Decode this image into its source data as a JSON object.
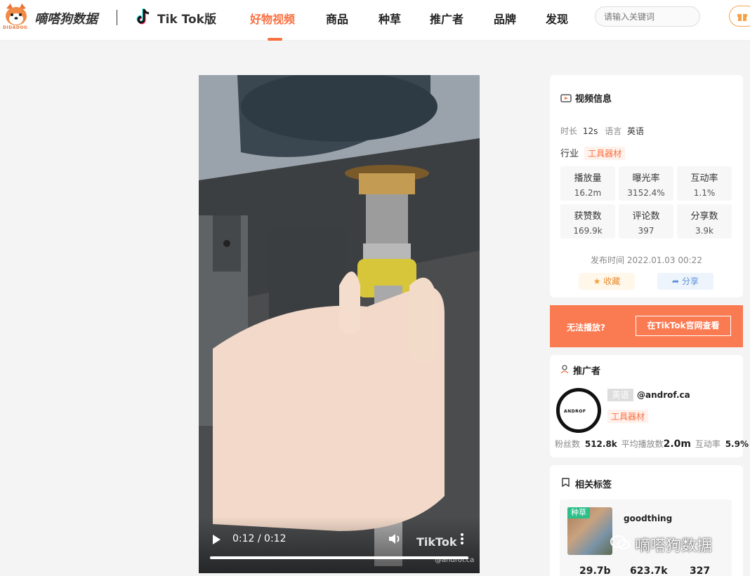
{
  "header": {
    "brand": "嘀嗒狗数据",
    "brand_badge": "DIDADOG",
    "platform": "Tik Tok版",
    "nav": [
      "好物视频",
      "商品",
      "种草",
      "推广者",
      "品牌",
      "发现"
    ],
    "search_placeholder": "请输入关键词"
  },
  "video": {
    "time": "0:12 / 0:12",
    "progress": 1.0,
    "watermark": "TikTok",
    "watermark_sub": "@androf.ca"
  },
  "video_info": {
    "title": "视频信息",
    "duration_label": "时长",
    "duration": "12s",
    "lang_label": "语言",
    "lang": "英语",
    "industry_label": "行业",
    "industry": "工具器材",
    "stats": [
      {
        "label": "播放量",
        "value": "16.2m"
      },
      {
        "label": "曝光率",
        "value": "3152.4%"
      },
      {
        "label": "互动率",
        "value": "1.1%"
      },
      {
        "label": "获赞数",
        "value": "169.9k"
      },
      {
        "label": "评论数",
        "value": "397"
      },
      {
        "label": "分享数",
        "value": "3.9k"
      }
    ],
    "publish": "发布时间 2022.01.03 00:22",
    "fav_label": "收藏",
    "share_label": "分享"
  },
  "notice": {
    "text": "无法播放?",
    "button": "在TikTok官网查看"
  },
  "promoter": {
    "title": "推广者",
    "avatar_text": "ANDROF",
    "lang_badge": "英语",
    "handle": "@androf.ca",
    "category": "工具器材",
    "fans_label": "粉丝数",
    "fans": "512.8k",
    "avg_play_label": "平均播放数",
    "avg_play": "2.0m",
    "engage_label": "互动率",
    "engage": "5.9%"
  },
  "tags": {
    "title": "相关标签",
    "card_badge": "种草",
    "card_name": "goodthing",
    "card_stats": [
      "29.7b",
      "623.7k",
      "327"
    ]
  },
  "overlay_watermark": "嘀嗒狗数据",
  "colors": {
    "accent": "#fa6f40",
    "notice": "#fa7b52"
  }
}
